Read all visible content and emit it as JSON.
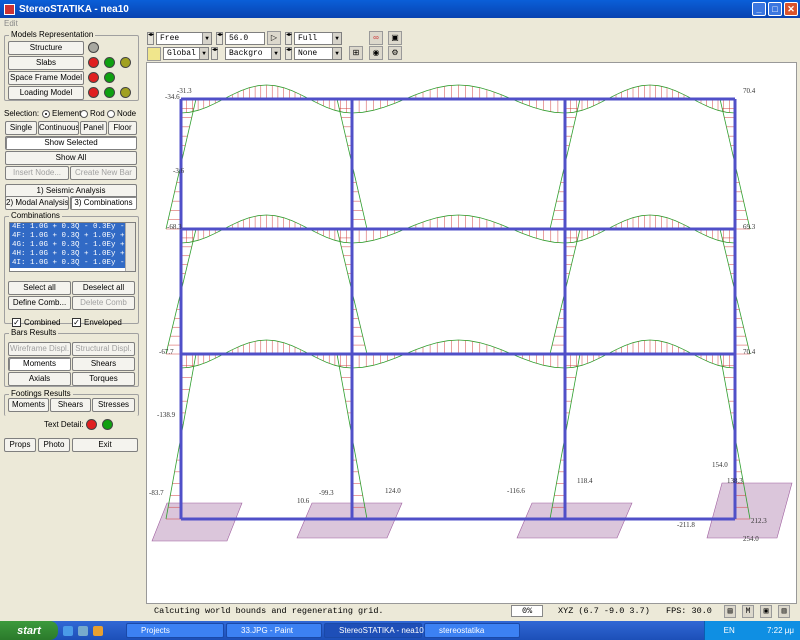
{
  "window": {
    "title": "StereoSTATIKA - nea10",
    "menu": "Edit"
  },
  "left_panel": {
    "models_group": "Models Representation",
    "structure": "Structure",
    "slabs": "Slabs",
    "space_frame": "Space Frame Model",
    "loading": "Loading Model",
    "selection_label": "Selection:",
    "radio_element": "Element",
    "radio_rod": "Rod",
    "radio_node": "Node",
    "single": "Single",
    "continuous": "Continuous",
    "panel": "Panel",
    "floor": "Floor",
    "show_selected": "Show Selected",
    "show_all": "Show All",
    "insert_node": "Insert Node...",
    "create_new_bar": "Create New Bar",
    "tab_seismic": "1) Seismic Analysis",
    "tab_modal": "2) Modal Analysis",
    "tab_combinations": "3) Combinations",
    "combinations_group": "Combinations",
    "combinations": [
      "4E: 1.0G + 0.3Q - 0.3Ey -",
      "4F: 1.0G + 0.3Q + 1.0Ey +",
      "4G: 1.0G + 0.3Q - 1.0Ey +",
      "4H: 1.0G + 0.3Q + 1.0Ey +",
      "4I: 1.0G + 0.3Q - 1.0Ey -"
    ],
    "select_all": "Select all",
    "deselect_all": "Deselect all",
    "define_comb": "Define Comb...",
    "delete_comb": "Delete Comb",
    "combined": "Combined",
    "enveloped": "Enveloped",
    "bars_results": "Bars Results",
    "wireframe_displ": "Wireframe Displ.",
    "structural_displ": "Structural Displ.",
    "moments": "Moments",
    "shears": "Shears",
    "axials": "Axials",
    "torques": "Torques",
    "footings_results": "Footings Results",
    "f_moments": "Moments",
    "f_shears": "Shears",
    "f_stresses": "Stresses",
    "text_detail": "Text Detail:",
    "props": "Props",
    "photo": "Photo",
    "exit": "Exit"
  },
  "toolbar": {
    "view_mode": "Free",
    "zoom": "56.0",
    "display": "Full",
    "coord": "Global",
    "background": "Backgro",
    "overlay": "None"
  },
  "viewport": {
    "labels": [
      "-34.6",
      "-31.3",
      "70.4",
      "-68.3",
      "69.3",
      "-67.7",
      "70.4",
      "-138.9",
      "-83.7",
      "-99.3",
      "-116.6",
      "118.4",
      "124.0",
      "-211.8",
      "154.0",
      "138.3",
      "212.3",
      "254.0",
      "-3.6",
      "10.6"
    ]
  },
  "status": {
    "message": "Calcuting world bounds and regenerating grid.",
    "progress": "0%",
    "xyz": "XYZ (6.7 -9.0 3.7)",
    "fps": "FPS: 30.0"
  },
  "taskbar": {
    "start": "start",
    "tasks": [
      "Projects",
      "33.JPG - Paint",
      "StereoSTATIKA - nea10",
      "stereostatika"
    ],
    "lang": "EN",
    "time": "7:22 μμ"
  },
  "colors": {
    "frame": "#5050c8",
    "moment": "#d04040",
    "shear": "#30a030",
    "footing": "#b080b0"
  }
}
